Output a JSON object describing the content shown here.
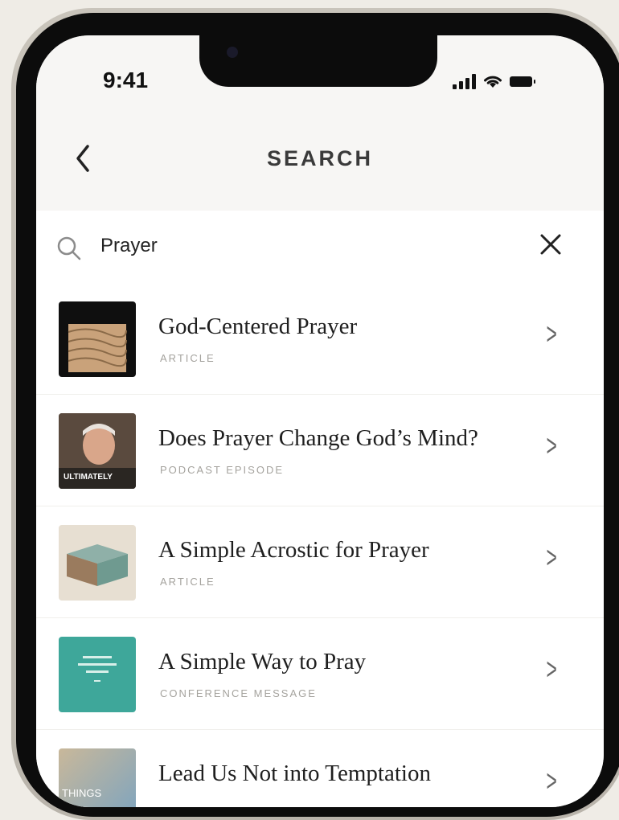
{
  "status": {
    "time": "9:41"
  },
  "header": {
    "title": "SEARCH",
    "back_icon": "chevron-left-icon"
  },
  "search": {
    "query": "Prayer",
    "placeholder": "",
    "search_icon": "magnifier-icon",
    "clear_icon": "close-icon"
  },
  "results": [
    {
      "title": "God-Centered Prayer",
      "type": "ARTICLE"
    },
    {
      "title": "Does Prayer Change God’s Mind?",
      "type": "PODCAST EPISODE"
    },
    {
      "title": "A Simple Acrostic for Prayer",
      "type": "ARTICLE"
    },
    {
      "title": "A Simple Way to Pray",
      "type": "CONFERENCE MESSAGE"
    },
    {
      "title": "Lead Us Not into Temptation",
      "type": ""
    }
  ],
  "thumbnails": {
    "t2_caption": "ULTIMATELY",
    "t5_caption": "THINGS"
  },
  "colors": {
    "background": "#efece6",
    "header_bg": "#f7f6f4",
    "text": "#1f1f1f",
    "muted": "#a5a39e",
    "teal": "#3ea79a"
  }
}
